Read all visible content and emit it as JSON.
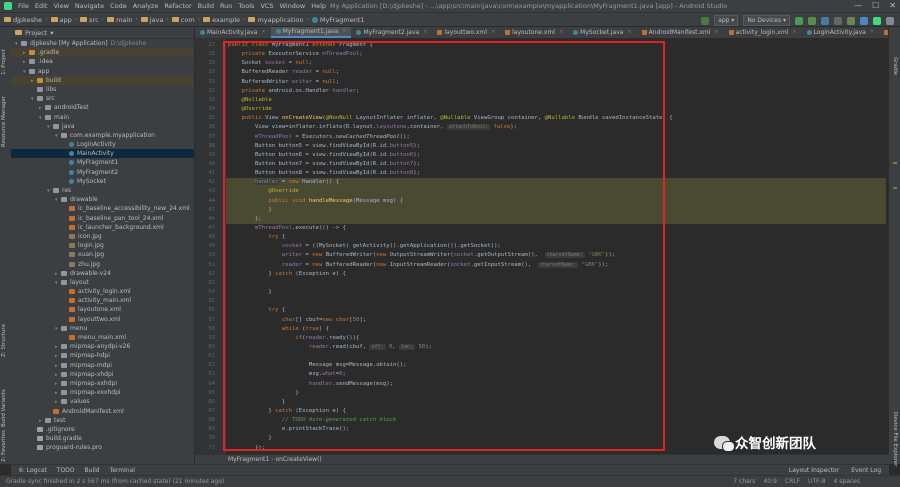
{
  "menubar": {
    "items": [
      "File",
      "Edit",
      "View",
      "Navigate",
      "Code",
      "Analyze",
      "Refactor",
      "Build",
      "Run",
      "Tools",
      "VCS",
      "Window",
      "Help"
    ],
    "title": "My Application [D:\\djpkeshe] - ...\\app\\src\\main\\java\\com\\example\\myapplication\\MyFragment1.java [app] - Android Studio",
    "window_controls": [
      "—",
      "☐",
      "✕"
    ]
  },
  "navbar": {
    "crumbs": [
      "djpkeshe",
      "app",
      "src",
      "main",
      "java",
      "com",
      "example",
      "myapplication",
      "MyFragment1"
    ],
    "run_config": "app",
    "device": "No Devices"
  },
  "left_stripe": [
    "1: Project",
    "Resource Manager",
    "Z: Structure",
    "Build Variants",
    "2: Favorites"
  ],
  "right_stripe": [
    "Gradle",
    "Device File Explorer"
  ],
  "project_panel": {
    "title": "Project",
    "tree": [
      {
        "label": "djpkeshe [My Application]",
        "extra": "D:\\djpkeshe",
        "indent": 0,
        "arrow": "▾",
        "icon": "ic-folder"
      },
      {
        "label": ".gradle",
        "indent": 1,
        "arrow": "▸",
        "icon": "ic-ofolder",
        "hl": true
      },
      {
        "label": ".idea",
        "indent": 1,
        "arrow": "▸",
        "icon": "ic-folder"
      },
      {
        "label": "app",
        "indent": 1,
        "arrow": "▾",
        "icon": "ic-folder"
      },
      {
        "label": "build",
        "indent": 2,
        "arrow": "▸",
        "icon": "ic-ofolder",
        "hl": true
      },
      {
        "label": "libs",
        "indent": 2,
        "arrow": "",
        "icon": "ic-folder"
      },
      {
        "label": "src",
        "indent": 2,
        "arrow": "▾",
        "icon": "ic-folder"
      },
      {
        "label": "androidTest",
        "indent": 3,
        "arrow": "▸",
        "icon": "ic-folder"
      },
      {
        "label": "main",
        "indent": 3,
        "arrow": "▾",
        "icon": "ic-folder"
      },
      {
        "label": "java",
        "indent": 4,
        "arrow": "▾",
        "icon": "ic-folder"
      },
      {
        "label": "com.example.myapplication",
        "indent": 5,
        "arrow": "▾",
        "icon": "ic-pkg"
      },
      {
        "label": "LoginActivity",
        "indent": 6,
        "arrow": "",
        "icon": "ic-java"
      },
      {
        "label": "MainActivity",
        "indent": 6,
        "arrow": "",
        "icon": "ic-java",
        "sel": true
      },
      {
        "label": "MyFragment1",
        "indent": 6,
        "arrow": "",
        "icon": "ic-java"
      },
      {
        "label": "MyFragment2",
        "indent": 6,
        "arrow": "",
        "icon": "ic-java"
      },
      {
        "label": "MySocket",
        "indent": 6,
        "arrow": "",
        "icon": "ic-java"
      },
      {
        "label": "res",
        "indent": 4,
        "arrow": "▾",
        "icon": "ic-folder"
      },
      {
        "label": "drawable",
        "indent": 5,
        "arrow": "▾",
        "icon": "ic-folder"
      },
      {
        "label": "ic_baseline_accessibility_new_24.xml",
        "indent": 6,
        "arrow": "",
        "icon": "ic-xml"
      },
      {
        "label": "ic_baseline_pan_tool_24.xml",
        "indent": 6,
        "arrow": "",
        "icon": "ic-xml"
      },
      {
        "label": "ic_launcher_background.xml",
        "indent": 6,
        "arrow": "",
        "icon": "ic-xml"
      },
      {
        "label": "icon.jpg",
        "indent": 6,
        "arrow": "",
        "icon": "ic-img"
      },
      {
        "label": "login.jpg",
        "indent": 6,
        "arrow": "",
        "icon": "ic-img"
      },
      {
        "label": "xuan.jpg",
        "indent": 6,
        "arrow": "",
        "icon": "ic-img"
      },
      {
        "label": "zhu.jpg",
        "indent": 6,
        "arrow": "",
        "icon": "ic-img"
      },
      {
        "label": "drawable-v24",
        "indent": 5,
        "arrow": "▸",
        "icon": "ic-folder"
      },
      {
        "label": "layout",
        "indent": 5,
        "arrow": "▾",
        "icon": "ic-folder"
      },
      {
        "label": "activity_login.xml",
        "indent": 6,
        "arrow": "",
        "icon": "ic-xml"
      },
      {
        "label": "activity_main.xml",
        "indent": 6,
        "arrow": "",
        "icon": "ic-xml"
      },
      {
        "label": "layoutone.xml",
        "indent": 6,
        "arrow": "",
        "icon": "ic-xml"
      },
      {
        "label": "layouttwo.xml",
        "indent": 6,
        "arrow": "",
        "icon": "ic-xml"
      },
      {
        "label": "menu",
        "indent": 5,
        "arrow": "▾",
        "icon": "ic-folder"
      },
      {
        "label": "menu_main.xml",
        "indent": 6,
        "arrow": "",
        "icon": "ic-xml"
      },
      {
        "label": "mipmap-anydpi-v26",
        "indent": 5,
        "arrow": "▸",
        "icon": "ic-folder"
      },
      {
        "label": "mipmap-hdpi",
        "indent": 5,
        "arrow": "▸",
        "icon": "ic-folder"
      },
      {
        "label": "mipmap-mdpi",
        "indent": 5,
        "arrow": "▸",
        "icon": "ic-folder"
      },
      {
        "label": "mipmap-xhdpi",
        "indent": 5,
        "arrow": "▸",
        "icon": "ic-folder"
      },
      {
        "label": "mipmap-xxhdpi",
        "indent": 5,
        "arrow": "▸",
        "icon": "ic-folder"
      },
      {
        "label": "mipmap-xxxhdpi",
        "indent": 5,
        "arrow": "▸",
        "icon": "ic-folder"
      },
      {
        "label": "values",
        "indent": 5,
        "arrow": "▸",
        "icon": "ic-folder"
      },
      {
        "label": "AndroidManifest.xml",
        "indent": 4,
        "arrow": "",
        "icon": "ic-xml"
      },
      {
        "label": "test",
        "indent": 3,
        "arrow": "▸",
        "icon": "ic-folder"
      },
      {
        "label": ".gitignore",
        "indent": 2,
        "arrow": "",
        "icon": "ic-file"
      },
      {
        "label": "build.gradle",
        "indent": 2,
        "arrow": "",
        "icon": "ic-file"
      },
      {
        "label": "proguard-rules.pro",
        "indent": 2,
        "arrow": "",
        "icon": "ic-file"
      }
    ]
  },
  "editor": {
    "tabs": [
      {
        "label": "MainActivity.java"
      },
      {
        "label": "MyFragment1.java",
        "active": true
      },
      {
        "label": "MyFragment2.java"
      },
      {
        "label": "layouttwo.xml"
      },
      {
        "label": "layoutone.xml"
      },
      {
        "label": "MySocket.java"
      },
      {
        "label": "AndroidManifest.xml"
      },
      {
        "label": "activity_login.xml"
      },
      {
        "label": "LoginActivity.java"
      },
      {
        "label": "activity_main.xml"
      }
    ],
    "first_line_number": 27,
    "lines": [
      "<span class=\"kw\">public class</span> MyFragment1 <span class=\"kw\">extends</span> Fragment {",
      "    <span class=\"kw\">private</span> ExecutorService <span class=\"fd\">mThreadPool</span>;",
      "    Socket <span class=\"fd\">socket</span> = <span class=\"kw\">null</span>;",
      "    BufferedReader <span class=\"fd\">reader</span> = <span class=\"kw\">null</span>;",
      "    BufferedWriter <span class=\"fd\">writer</span> = <span class=\"kw\">null</span>;",
      "    <span class=\"kw\">private</span> android.os.Handler <span class=\"fd\">handler</span>;",
      "    <span class=\"an\">@Nullable</span>",
      "    <span class=\"an\">@Override</span>",
      "    <span class=\"kw\">public</span> View <span class=\"fn\">onCreateView</span>(<span class=\"an\">@NonNull</span> LayoutInflater inflater, <span class=\"an\">@Nullable</span> ViewGroup container, <span class=\"an\">@Nullable</span> Bundle savedInstanceState) {",
      "        View view=inflater.inflate(R.layout.<span class=\"fd\">layoutone</span>,container, <span class=\"hint\">attachToRoot:</span> <span class=\"kw\">false</span>);",
      "        <span class=\"fd\">mThreadPool</span> = Executors.<i>newCachedThreadPool</i>();",
      "        Button button5 = view.findViewById(R.id.<span class=\"fd\">button5</span>);",
      "        Button button6 = view.findViewById(R.id.<span class=\"fd\">button6</span>);",
      "        Button button7 = view.findViewById(R.id.<span class=\"fd\">button7</span>);",
      "        Button button8 = view.findViewById(R.id.<span class=\"fd\">button8</span>);",
      "        <span class=\"fd ref\">handler</span> = <span class=\"kw\">new</span> Handler() {",
      "            <span class=\"an\">@Override</span>",
      "            <span class=\"kw\">public void</span> <span class=\"fn\">handleMessage</span>(Message msg) {",
      "            }",
      "        };",
      "        <span class=\"fd\">mThreadPool</span>.execute(() -> {",
      "            <span class=\"kw\">try</span> {",
      "                <span class=\"fd\">socket</span> = ((MySocket) getActivity().getApplication()).getSocket();",
      "                <span class=\"fd\">writer</span> = <span class=\"kw\">new</span> BufferedWriter(<span class=\"kw\">new</span> OutputStreamWriter(<span class=\"fd\">socket</span>.getOutputStream(),  <span class=\"hint\">charsetName:</span> <span class=\"st\">\"GBK\"</span>));",
      "                <span class=\"fd\">reader</span> = <span class=\"kw\">new</span> BufferedReader(<span class=\"kw\">new</span> InputStreamReader(<span class=\"fd\">socket</span>.getInputStream(),  <span class=\"hint\">charsetName:</span> <span class=\"st\">\"GBK\"</span>));",
      "            } <span class=\"kw\">catch</span> (Exception e) {",
      "",
      "            }",
      "",
      "            <span class=\"kw\">try</span> {",
      "                <span class=\"kw\">char</span>[] cbuf=<span class=\"kw\">new char</span>[<span class=\"fd\">50</span>];",
      "                <span class=\"kw\">while</span> (<span class=\"kw\">true</span>) {",
      "                    <span class=\"kw\">if</span>(<span class=\"fd\">reader</span>.ready()){",
      "                        <span class=\"fd\">reader</span>.read(cbuf, <span class=\"hint\">off:</span> <span class=\"fd\">0</span>, <span class=\"hint\">len:</span> <span class=\"fd\">50</span>);",
      "",
      "                        Message msg=Message.<i>obtain</i>();",
      "                        msg.<span class=\"fd\">what</span>=<span class=\"fd\">0</span>;",
      "                        <span class=\"fd\">handler</span>.sendMessage(msg);",
      "                    }",
      "                }",
      "            } <span class=\"kw\">catch</span> (Exception e) {",
      "                <span class=\"cm\">// TODO Auto-generated catch block</span>",
      "                e.printStackTrace();",
      "            }",
      "        });"
    ],
    "highlight_lines": [
      15,
      16,
      17,
      18,
      19
    ],
    "breadcrumb": [
      "MyFragment1",
      "onCreateView()"
    ]
  },
  "tool_windows": {
    "left": [
      "6: Logcat",
      "TODO",
      "Build",
      "Terminal"
    ],
    "right": [
      "Layout Inspector",
      "Event Log"
    ]
  },
  "status": {
    "message": "Gradle sync finished in 2 s 567 ms (from cached state) (21 minutes ago)",
    "chars": "7 chars",
    "position": "40:9",
    "line_sep": "CRLF",
    "encoding": "UTF-8",
    "indent": "4 spaces"
  },
  "watermark": {
    "text": "众智创新团队"
  },
  "colors": {
    "accent": "#4a88c7",
    "selection": "#0d293e",
    "redbox": "#e02424"
  }
}
